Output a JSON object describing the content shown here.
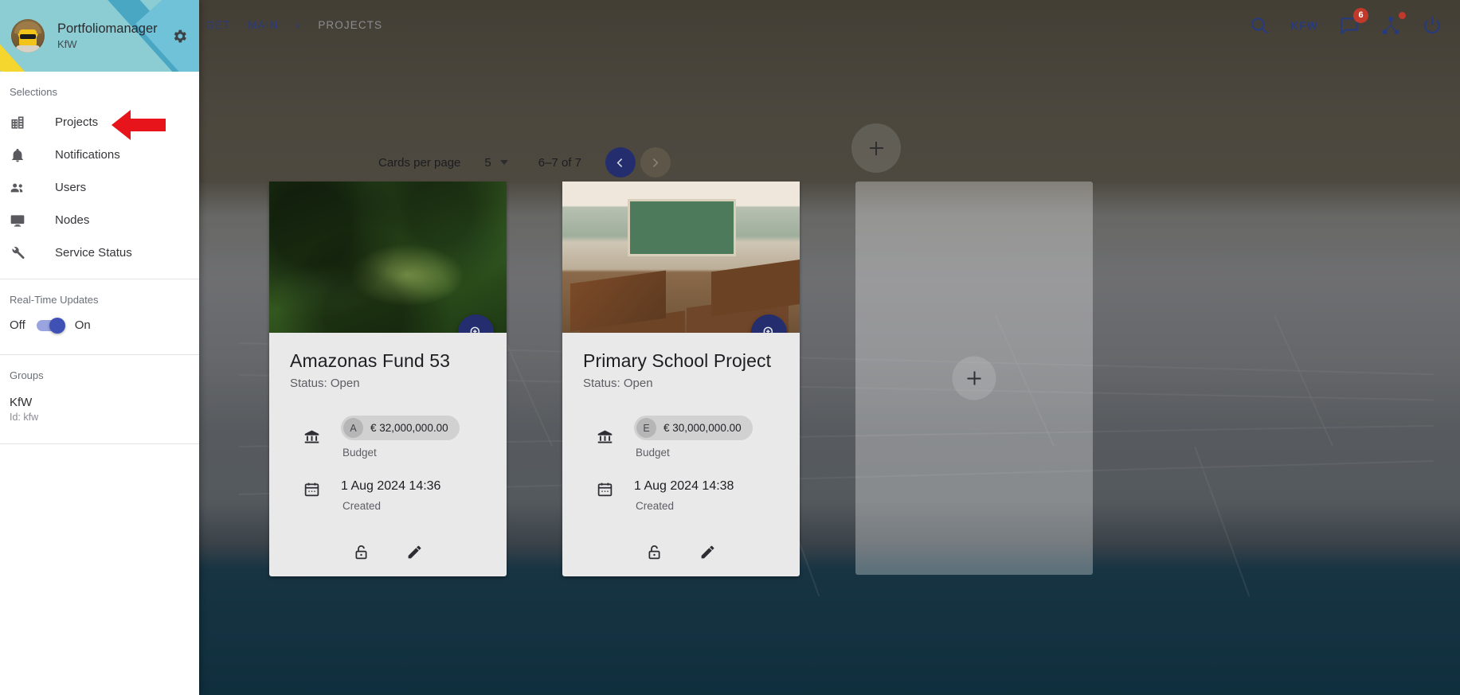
{
  "drawer": {
    "user_name": "Portfoliomanager",
    "user_org": "KfW",
    "settings_icon": "gear-icon",
    "selections_label": "Selections",
    "nav_items": [
      {
        "label": "Projects",
        "icon": "building-icon"
      },
      {
        "label": "Notifications",
        "icon": "bell-icon"
      },
      {
        "label": "Users",
        "icon": "people-icon"
      },
      {
        "label": "Nodes",
        "icon": "monitor-icon"
      },
      {
        "label": "Service Status",
        "icon": "wrench-icon"
      }
    ],
    "realtime_label": "Real-Time Updates",
    "realtime_off": "Off",
    "realtime_on": "On",
    "realtime_state": "on",
    "groups_label": "Groups",
    "groups": [
      {
        "name": "KfW",
        "id_text": "Id: kfw"
      }
    ]
  },
  "topbar": {
    "breadcrumb": [
      {
        "text": "GET",
        "active": true
      },
      {
        "text": "MAIN",
        "active": true
      },
      {
        "text": "PROJECTS",
        "active": false
      }
    ],
    "separator": "›",
    "search_icon": "search-icon",
    "tenant_label": "KFW",
    "messages_icon": "chat-icon",
    "messages_badge": "6",
    "network_icon": "share-nodes-icon",
    "power_icon": "power-icon"
  },
  "paginator": {
    "cards_per_page_label": "Cards per page",
    "cards_per_page_value": "5",
    "range_label": "6–7 of 7",
    "prev_label": "Previous page",
    "next_label": "Next page",
    "prev_enabled": true,
    "next_enabled": false
  },
  "cards": [
    {
      "title": "Amazonas Fund 53",
      "status": "Status: Open",
      "media": "jungle-photo",
      "zoom_icon": "zoom-in-icon",
      "budget": {
        "icon": "bank-icon",
        "chip_avatar": "A",
        "chip_value": "€ 32,000,000.00",
        "label": "Budget"
      },
      "created": {
        "icon": "calendar-icon",
        "value": "1 Aug 2024 14:36",
        "label": "Created"
      },
      "actions": [
        {
          "icon": "unlock-icon",
          "name": "unlock-button"
        },
        {
          "icon": "pencil-icon",
          "name": "edit-button"
        }
      ]
    },
    {
      "title": "Primary School Project",
      "status": "Status: Open",
      "media": "school-photo",
      "zoom_icon": "zoom-in-icon",
      "budget": {
        "icon": "bank-icon",
        "chip_avatar": "E",
        "chip_value": "€ 30,000,000.00",
        "label": "Budget"
      },
      "created": {
        "icon": "calendar-icon",
        "value": "1 Aug 2024 14:38",
        "label": "Created"
      },
      "actions": [
        {
          "icon": "unlock-icon",
          "name": "unlock-button"
        },
        {
          "icon": "pencil-icon",
          "name": "edit-button"
        }
      ]
    }
  ],
  "add_card": {
    "icon": "plus-icon"
  },
  "add_fab_top": {
    "icon": "plus-icon"
  },
  "annotation": {
    "arrow": "red-arrow-pointing-left",
    "color": "#e8141b"
  },
  "colors": {
    "accent_navy": "#242e6e",
    "toggle_on": "#3f51b5",
    "badge_red": "#c0392b",
    "annotation_red": "#e8141b",
    "drawer_header": "#8ccdd3"
  }
}
